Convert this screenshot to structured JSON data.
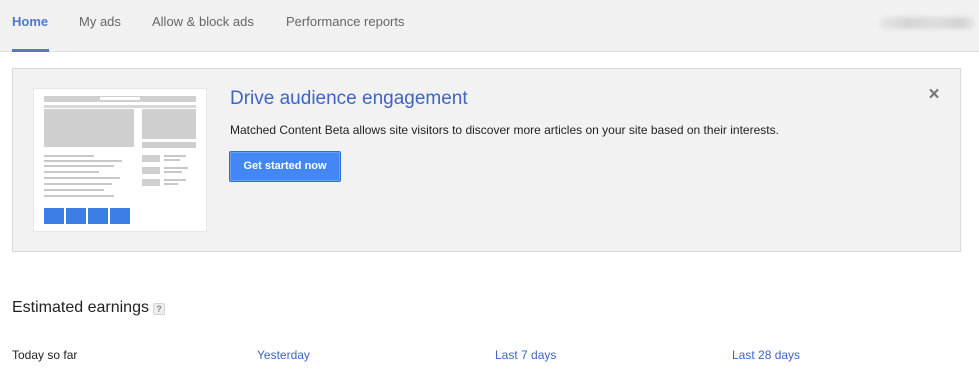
{
  "nav": {
    "tabs": [
      {
        "label": "Home",
        "active": true
      },
      {
        "label": "My ads",
        "active": false
      },
      {
        "label": "Allow & block ads",
        "active": false
      },
      {
        "label": "Performance reports",
        "active": false
      }
    ],
    "accent_color": "#4d79c9"
  },
  "promo": {
    "title": "Drive audience engagement",
    "description": "Matched Content Beta allows site visitors to discover more articles on your site based on their interests.",
    "cta_label": "Get started now",
    "close_icon": "close-icon",
    "title_color": "#3e64c6",
    "button_color": "#4287f5"
  },
  "earnings": {
    "title": "Estimated earnings",
    "help_icon": "?",
    "periods": [
      {
        "label": "Today so far",
        "link": false
      },
      {
        "label": "Yesterday",
        "link": true
      },
      {
        "label": "Last 7 days",
        "link": true
      },
      {
        "label": "Last 28 days",
        "link": true
      }
    ]
  }
}
